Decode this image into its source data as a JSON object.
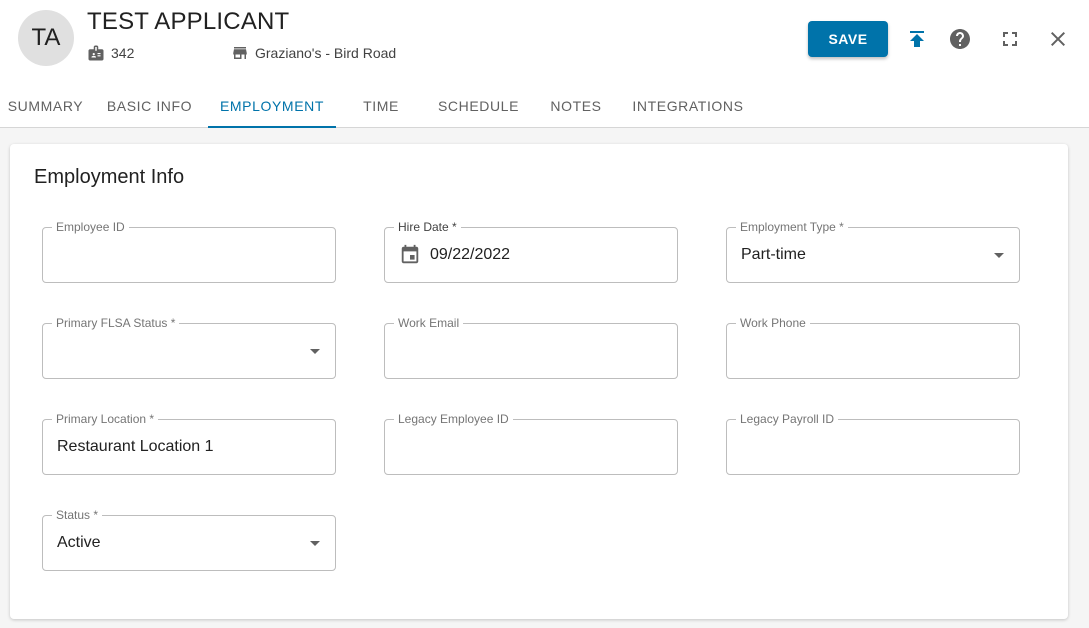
{
  "header": {
    "avatar_initials": "TA",
    "title": "TEST APPLICANT",
    "employee_number": "342",
    "location_name": "Graziano's - Bird Road",
    "save_label": "SAVE"
  },
  "tabs": [
    {
      "label": "SUMMARY"
    },
    {
      "label": "BASIC INFO"
    },
    {
      "label": "EMPLOYMENT",
      "active": true
    },
    {
      "label": "TIME"
    },
    {
      "label": "SCHEDULE"
    },
    {
      "label": "NOTES"
    },
    {
      "label": "INTEGRATIONS"
    }
  ],
  "section": {
    "title": "Employment Info"
  },
  "fields": {
    "employee_id": {
      "label": "Employee ID",
      "value": ""
    },
    "hire_date": {
      "label": "Hire Date *",
      "value": "09/22/2022"
    },
    "employment_type": {
      "label": "Employment Type *",
      "value": "Part-time"
    },
    "primary_flsa_status": {
      "label": "Primary FLSA Status *",
      "value": ""
    },
    "work_email": {
      "label": "Work Email",
      "value": ""
    },
    "work_phone": {
      "label": "Work Phone",
      "value": ""
    },
    "primary_location": {
      "label": "Primary Location *",
      "value": "Restaurant Location 1"
    },
    "legacy_employee_id": {
      "label": "Legacy Employee ID",
      "value": ""
    },
    "legacy_payroll_id": {
      "label": "Legacy Payroll ID",
      "value": ""
    },
    "status": {
      "label": "Status *",
      "value": "Active"
    }
  },
  "colors": {
    "accent": "#0073aa",
    "avatar_bg": "#e0e0e0"
  },
  "icons": [
    "badge-icon",
    "store-icon",
    "publish-icon",
    "help-icon",
    "fullscreen-icon",
    "close-icon",
    "calendar-icon",
    "dropdown-arrow-icon"
  ]
}
